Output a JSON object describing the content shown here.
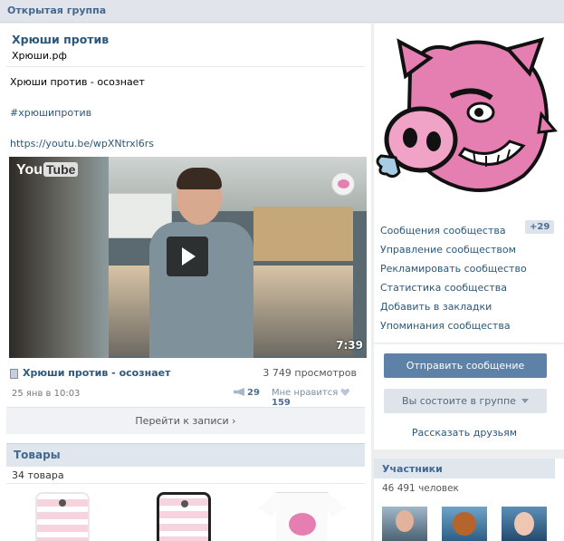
{
  "topbar": {
    "label": "Открытая группа"
  },
  "group": {
    "title": "Хрюши против",
    "site": "Хрюши.рф"
  },
  "post": {
    "text": "Хрюши против - осознает",
    "hashtag": "#хрюшипротив",
    "link": "https://youtu.be/wpXNtrxl6rs",
    "video": {
      "logo_you": "You",
      "logo_tube": "Tube",
      "duration": "7:39",
      "title": "Хрюши против - осознает",
      "views": "3 749 просмотров"
    },
    "date": "25 янв в 10:03",
    "reposts": "29",
    "likes_label": "Мне нравится",
    "likes": "159",
    "goto_label": "Перейти к записи"
  },
  "goods": {
    "title": "Товары",
    "count": "34 товара"
  },
  "menu": {
    "items": [
      {
        "label": "Сообщения сообщества"
      },
      {
        "label": "Управление сообществом"
      },
      {
        "label": "Рекламировать сообщество"
      },
      {
        "label": "Статистика сообщества"
      },
      {
        "label": "Добавить в закладки"
      },
      {
        "label": "Упоминания сообщества"
      }
    ],
    "messages_badge": "+29"
  },
  "actions": {
    "send_label": "Отправить сообщение",
    "member_label": "Вы состоите в группе",
    "tell_label": "Рассказать друзьям"
  },
  "members": {
    "title": "Участники",
    "count": "46 491 человек"
  },
  "colors": {
    "link": "#2b587a",
    "button": "#5e81a8",
    "header": "#dfe6ee",
    "pig": "#e57fb1"
  }
}
